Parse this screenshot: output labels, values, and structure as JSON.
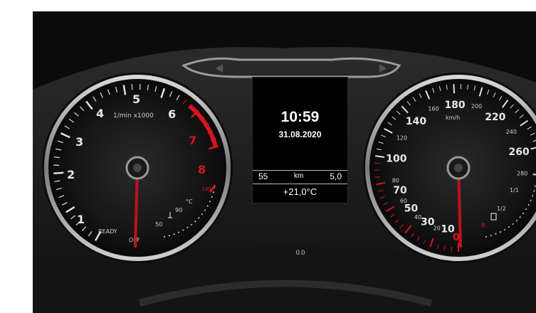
{
  "tachometer": {
    "numbers": [
      "1",
      "2",
      "3",
      "4",
      "5",
      "6",
      "7",
      "8"
    ],
    "unit_label": "1/min x1000",
    "ready_label": "READY",
    "off_label": "OFF",
    "temp_labels": [
      "°C",
      "90",
      "50",
      "130"
    ],
    "redline_from": 6.5
  },
  "speedometer": {
    "numbers": [
      "10",
      "20",
      "30",
      "40",
      "50",
      "60",
      "70",
      "80",
      "100",
      "120",
      "140",
      "160",
      "180",
      "200",
      "220",
      "240",
      "260",
      "280"
    ],
    "unit_label": "km/h",
    "reserve_label": "R",
    "fuel_labels": [
      "1/1",
      "1/2"
    ],
    "zero_label": "0"
  },
  "display": {
    "time": "10:59",
    "date": "31.08.2020",
    "left_value": "55",
    "unit": "km",
    "right_value": "5,0",
    "temperature": "+21,0°C"
  },
  "odometer": "0.0",
  "colors": {
    "accent_red": "#d9141e",
    "needle_red": "#c0121b"
  }
}
